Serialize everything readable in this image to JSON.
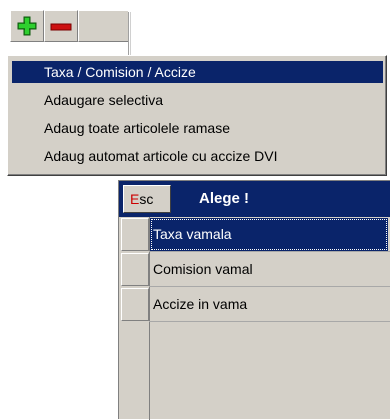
{
  "toolbar": {
    "add_button_icon": "green-plus-icon",
    "remove_button_icon": "red-minus-icon",
    "colors": {
      "plus": "#1e9e1e",
      "minus": "#cc1111"
    }
  },
  "menu": {
    "items": [
      {
        "label": "Taxa / Comision / Accize",
        "selected": true
      },
      {
        "label": "Adaugare selectiva",
        "selected": false
      },
      {
        "label": "Adaug toate articolele ramase",
        "selected": false
      },
      {
        "label": "Adaug automat articole cu accize DVI",
        "selected": false
      }
    ],
    "highlight_color": "#0a246a"
  },
  "panel": {
    "esc_key": "E",
    "esc_rest": "sc",
    "title": "Alege !",
    "rows": [
      {
        "label": "Taxa vamala",
        "selected": true
      },
      {
        "label": "Comision vamal",
        "selected": false
      },
      {
        "label": "Accize in vama",
        "selected": false
      }
    ]
  }
}
